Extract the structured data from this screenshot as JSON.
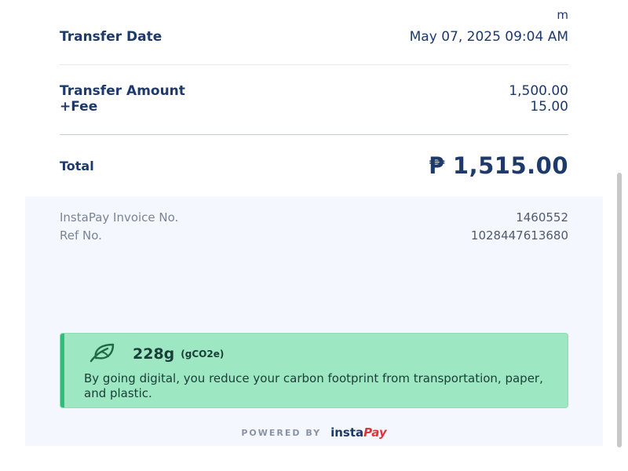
{
  "continued_fragment": "m",
  "transfer_date": {
    "label": "Transfer Date",
    "value": "May 07, 2025 09:04 AM"
  },
  "transfer_amount": {
    "label": "Transfer Amount",
    "value": "1,500.00"
  },
  "fee": {
    "label": "+Fee",
    "value": "15.00"
  },
  "total": {
    "label": "Total",
    "currency": "₱",
    "value": "1,515.00"
  },
  "invoice": {
    "label": "InstaPay Invoice No.",
    "value": "1460552"
  },
  "reference": {
    "label": "Ref No.",
    "value": "1028447613680"
  },
  "eco": {
    "icon": "leaf-icon",
    "amount": "228g",
    "unit": "(gCO2e)",
    "message": "By going digital, you reduce your carbon footprint from transportation, paper, and plastic."
  },
  "footer": {
    "powered_by": "POWERED BY",
    "brand_prefix": "insta",
    "brand_suffix": "Pay"
  },
  "colors": {
    "primary": "#1d3a6b",
    "eco_bg": "#9de8c2",
    "eco_accent": "#2bbf7a",
    "brand_red": "#e0343c",
    "panel": "#f4f7fd"
  }
}
